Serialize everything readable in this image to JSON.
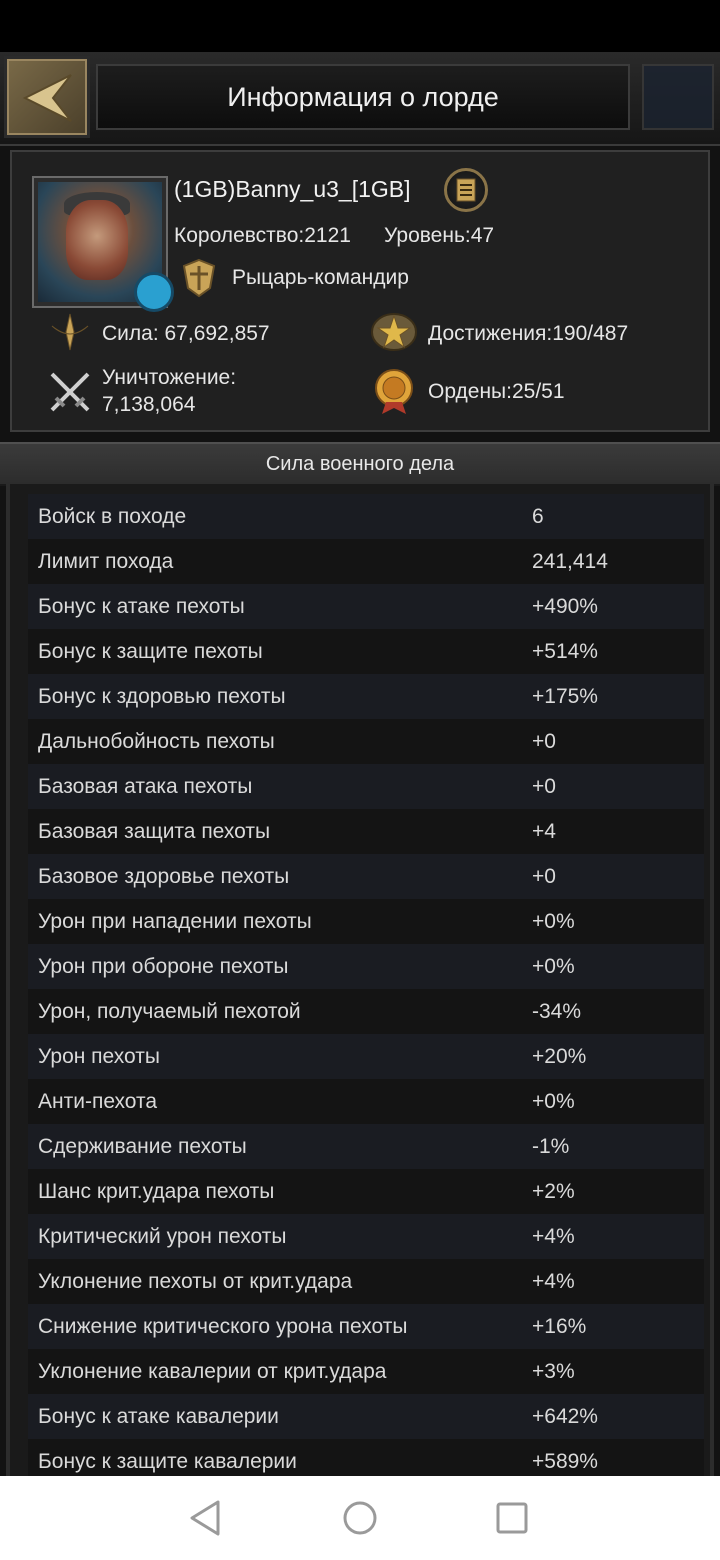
{
  "header": {
    "title": "Информация о лорде"
  },
  "profile": {
    "name": "(1GB)Banny_u3_[1GB]",
    "kingdom": "Королевство:2121",
    "level": "Уровень:47",
    "rank": "Рыцарь-командир",
    "power": "Сила: 67,692,857",
    "achievements": "Достижения:190/487",
    "kills_label": "Уничтожение:",
    "kills_value": "7,138,064",
    "medals": "Ордены:25/51"
  },
  "section": {
    "title": "Сила военного дела"
  },
  "stats": [
    {
      "label": "Войск в походе",
      "value": "6"
    },
    {
      "label": "Лимит похода",
      "value": "241,414"
    },
    {
      "label": "Бонус к атаке пехоты",
      "value": "+490%"
    },
    {
      "label": "Бонус к защите пехоты",
      "value": "+514%"
    },
    {
      "label": "Бонус к здоровью пехоты",
      "value": "+175%"
    },
    {
      "label": "Дальнобойность пехоты",
      "value": "+0"
    },
    {
      "label": "Базовая атака пехоты",
      "value": "+0"
    },
    {
      "label": "Базовая защита пехоты",
      "value": "+4"
    },
    {
      "label": "Базовое здоровье пехоты",
      "value": "+0"
    },
    {
      "label": "Урон при нападении пехоты",
      "value": "+0%"
    },
    {
      "label": "Урон при обороне пехоты",
      "value": "+0%"
    },
    {
      "label": "Урон, получаемый пехотой",
      "value": "-34%"
    },
    {
      "label": "Урон пехоты",
      "value": "+20%"
    },
    {
      "label": "Анти-пехота",
      "value": "+0%"
    },
    {
      "label": "Сдерживание пехоты",
      "value": "-1%"
    },
    {
      "label": "Шанс крит.удара пехоты",
      "value": "+2%"
    },
    {
      "label": "Критический урон пехоты",
      "value": "+4%"
    },
    {
      "label": "Уклонение пехоты от крит.удара",
      "value": "+4%"
    },
    {
      "label": "Снижение критического урона пехоты",
      "value": "+16%"
    },
    {
      "label": "Уклонение кавалерии от крит.удара",
      "value": "+3%"
    },
    {
      "label": "Бонус к атаке кавалерии",
      "value": "+642%"
    },
    {
      "label": "Бонус к защите кавалерии",
      "value": "+589%"
    }
  ]
}
